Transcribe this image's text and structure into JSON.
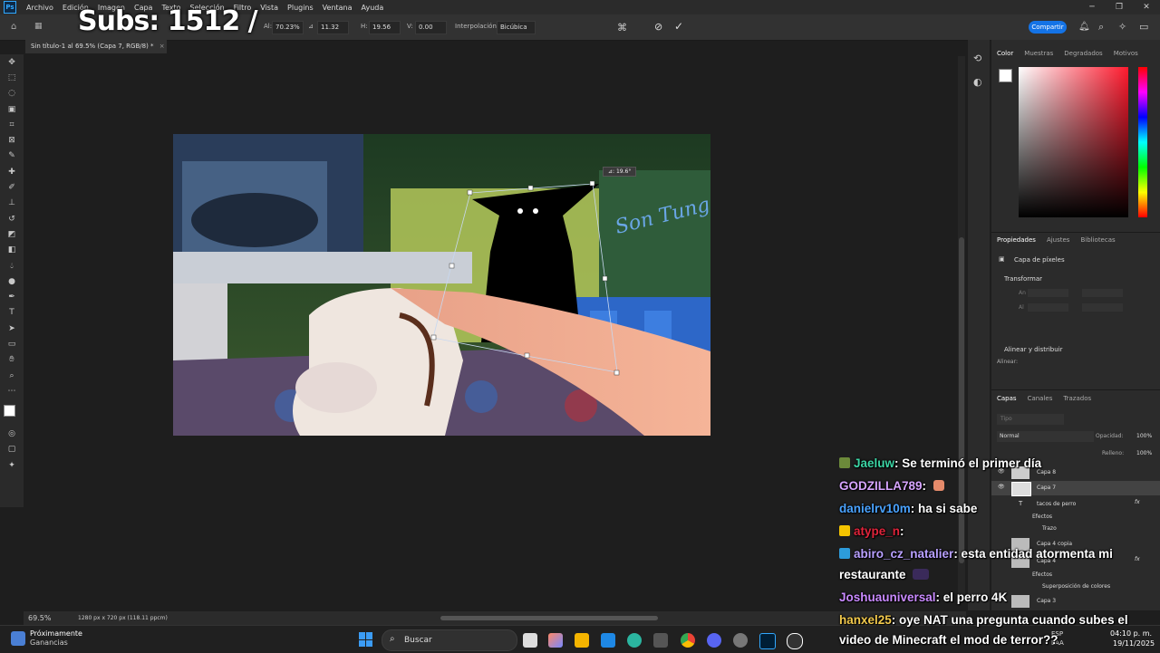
{
  "overlay": {
    "subs": "Subs: 1512 /"
  },
  "menu": [
    "Archivo",
    "Edición",
    "Imagen",
    "Capa",
    "Texto",
    "Selección",
    "Filtro",
    "Vista",
    "Plugins",
    "Ventana",
    "Ayuda"
  ],
  "options": {
    "w_label": "Al:",
    "w_value": "70.23%",
    "angle_value": "11.32",
    "h_label": "H:",
    "h_value": "19.56",
    "v_label": "V:",
    "v_value": "0.00",
    "interp_label": "Interpolación:",
    "interp_value": "Bicúbica",
    "share": "Compartir"
  },
  "document": {
    "tab": "Sin título-1 al 69.5% (Capa 7, RGB/8) *",
    "zoom": "69.5%",
    "dims": "1280 px x 720 px (118.11 ppcm)",
    "rotate_tip": "⊿: 19.6°"
  },
  "canvas_text": {
    "sign": "Son Tung"
  },
  "color_panel": {
    "tabs": [
      "Color",
      "Muestras",
      "Degradados",
      "Motivos"
    ]
  },
  "properties": {
    "tabs": [
      "Propiedades",
      "Ajustes",
      "Bibliotecas"
    ],
    "type": "Capa de píxeles",
    "transform": "Transformar",
    "an": "An",
    "al": "Al",
    "align": "Alinear y distribuir",
    "align_label": "Alinear:"
  },
  "layers": {
    "tabs": [
      "Capas",
      "Canales",
      "Trazados"
    ],
    "filter": "Tipo",
    "blend": "Normal",
    "opacity_label": "Opacidad:",
    "opacity": "100%",
    "fill_label": "Relleno:",
    "fill": "100%",
    "items": [
      "Capa 8",
      "Capa 7",
      "tacos de perro",
      "Efectos",
      "Trazo",
      "Capa 4 copia",
      "Capa 4",
      "Efectos",
      "Superposición de colores",
      "Capa 3"
    ]
  },
  "chat": [
    {
      "user": "Jaeluw",
      "user_color": "#3cd6a5",
      "msg": ": Se terminó el primer día"
    },
    {
      "user": "GODZILLA789",
      "user_color": "#d7a5ff",
      "msg": ":"
    },
    {
      "user": "danielrv10m",
      "user_color": "#4aa3ff",
      "msg": ": ha si sabe"
    },
    {
      "user": "atype_n",
      "user_color": "#e0243b",
      "msg": ":"
    },
    {
      "user": "abiro_cz_natalier",
      "user_color": "#b8a0ff",
      "msg": ": esta entidad atormenta mi"
    },
    {
      "user": "",
      "user_color": "#ffffff",
      "msg": "restaurante"
    },
    {
      "user": "Joshuauniversal",
      "user_color": "#c98aff",
      "msg": ": el perro 4K"
    },
    {
      "user": "hanxel25",
      "user_color": "#f2c94c",
      "msg": ": oye NAT una pregunta cuando subes el"
    },
    {
      "user": "",
      "user_color": "#ffffff",
      "msg": "video de Minecraft el mod de terror??"
    }
  ],
  "taskbar": {
    "weather_title": "Próximamente",
    "weather_sub": "Ganancias",
    "search": "Buscar",
    "lang": "ESP",
    "lang2": "LAA",
    "time": "04:10 p. m.",
    "date": "19/11/2025"
  }
}
